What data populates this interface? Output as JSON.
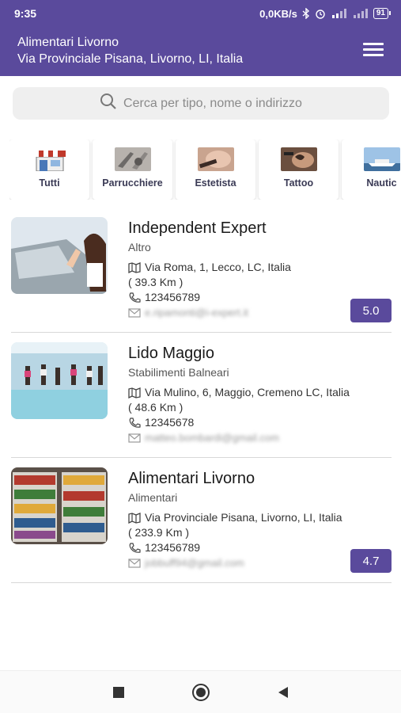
{
  "status": {
    "time": "9:35",
    "net_speed": "0,0KB/s",
    "battery": "91"
  },
  "header": {
    "title": "Alimentari Livorno",
    "subtitle": "Via Provinciale Pisana, Livorno, LI, Italia"
  },
  "search": {
    "placeholder": "Cerca per tipo, nome o indirizzo"
  },
  "categories": [
    {
      "label": "Tutti",
      "icon": "shop-icon"
    },
    {
      "label": "Parrucchiere",
      "icon": "hairdresser-image"
    },
    {
      "label": "Estetista",
      "icon": "beautician-image"
    },
    {
      "label": "Tattoo",
      "icon": "tattoo-image"
    },
    {
      "label": "Nautic",
      "icon": "boat-image"
    }
  ],
  "listings": [
    {
      "name": "Independent Expert",
      "category": "Altro",
      "address": "Via Roma, 1, Lecco, LC, Italia",
      "distance": "( 39.3 Km )",
      "phone": "123456789",
      "email": "e.ripamonti@i-expert.it",
      "rating": "5.0"
    },
    {
      "name": "Lido Maggio",
      "category": "Stabilimenti Balneari",
      "address": "Via Mulino, 6, Maggio, Cremeno LC, Italia",
      "distance": "( 48.6 Km )",
      "phone": "12345678",
      "email": "matteo.bombardi@gmail.com",
      "rating": ""
    },
    {
      "name": "Alimentari Livorno",
      "category": "Alimentari",
      "address": "Via Provinciale Pisana, Livorno, LI, Italia",
      "distance": "( 233.9 Km )",
      "phone": "123456789",
      "email": "jobbuff94@gmail.com",
      "rating": "4.7"
    }
  ],
  "colors": {
    "primary": "#5a4a9c",
    "search_bg": "#efefef"
  }
}
